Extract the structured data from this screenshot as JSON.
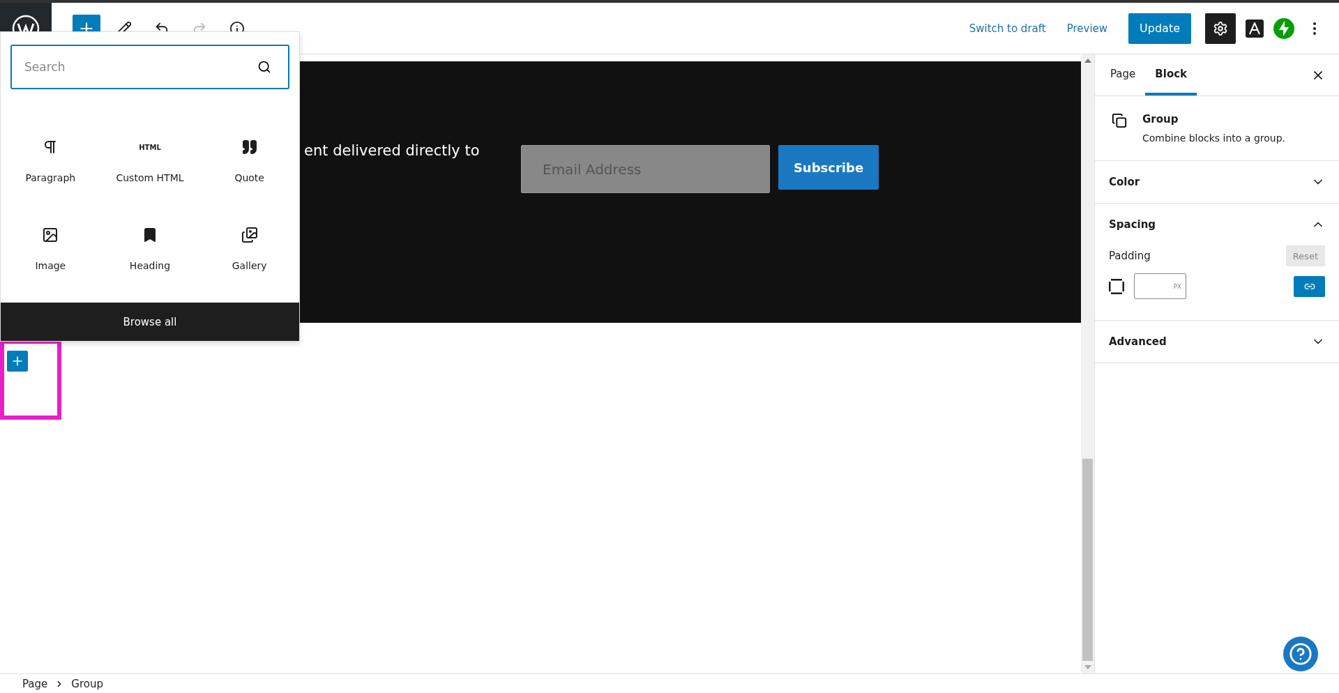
{
  "toolbar": {
    "actions": [
      {
        "kind": "link",
        "label": "Switch to draft"
      },
      {
        "kind": "link",
        "label": "Preview"
      },
      {
        "kind": "primary",
        "label": "Update"
      }
    ],
    "settings_active": true
  },
  "inserter": {
    "search": {
      "placeholder": "Search"
    },
    "blocks": [
      {
        "kind": "paragraph",
        "label": "Paragraph"
      },
      {
        "kind": "html",
        "label": "Custom HTML",
        "glyph": "HTML"
      },
      {
        "kind": "quote",
        "label": "Quote"
      },
      {
        "kind": "image",
        "label": "Image"
      },
      {
        "kind": "heading",
        "label": "Heading"
      },
      {
        "kind": "gallery",
        "label": "Gallery"
      }
    ],
    "browse_all": "Browse all"
  },
  "canvas": {
    "text": "ent delivered directly to",
    "email": {
      "placeholder": "Email Address"
    },
    "subscribe": "Subscribe"
  },
  "sidebar": {
    "tabs": [
      {
        "label": "Page",
        "selected": false
      },
      {
        "label": "Block",
        "selected": true
      }
    ],
    "block": {
      "title": "Group",
      "description": "Combine blocks into a group."
    },
    "panels": [
      {
        "title": "Color",
        "expanded": false
      },
      {
        "title": "Spacing",
        "expanded": true,
        "padding": {
          "label": "Padding",
          "reset": "Reset",
          "unit": "PX"
        }
      },
      {
        "title": "Advanced",
        "expanded": false
      }
    ]
  },
  "breadcrumb": [
    "Page",
    "Group"
  ]
}
